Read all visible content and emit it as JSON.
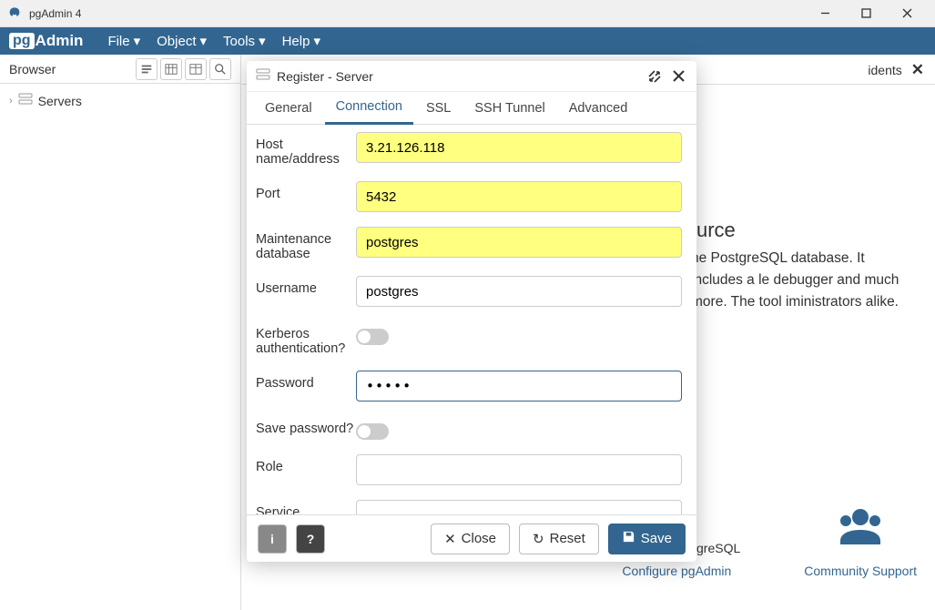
{
  "titlebar": {
    "title": "pgAdmin 4"
  },
  "menubar": {
    "items": [
      "File",
      "Object",
      "Tools",
      "Help"
    ]
  },
  "sidebar": {
    "title": "Browser",
    "root": "Servers"
  },
  "main_tab": {
    "label": "idents"
  },
  "background": {
    "heading_fragment": "urce",
    "desc_fragment": "he PostgreSQL database. It includes a le debugger and much more. The tool iministrators alike.",
    "card1": "Configure pgAdmin",
    "card2_right_fragment": "greSQL",
    "card3": "Community Support"
  },
  "dialog": {
    "title": "Register - Server",
    "tabs": [
      "General",
      "Connection",
      "SSL",
      "SSH Tunnel",
      "Advanced"
    ],
    "active_tab": "Connection",
    "fields": {
      "host_label": "Host name/address",
      "host_value": "3.21.126.118",
      "port_label": "Port",
      "port_value": "5432",
      "maintdb_label": "Maintenance database",
      "maintdb_value": "postgres",
      "username_label": "Username",
      "username_value": "postgres",
      "kerberos_label": "Kerberos authentication?",
      "password_label": "Password",
      "password_value": "•••••",
      "savepw_label": "Save password?",
      "role_label": "Role",
      "role_value": "",
      "service_label": "Service",
      "service_value": ""
    },
    "buttons": {
      "close": "Close",
      "reset": "Reset",
      "save": "Save"
    }
  }
}
